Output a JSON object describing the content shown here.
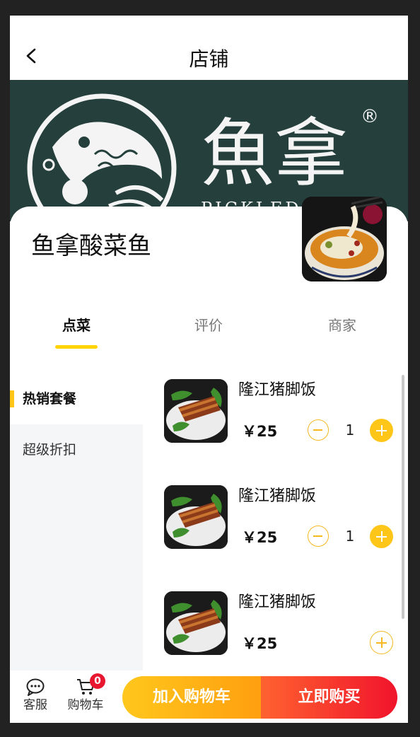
{
  "header": {
    "title": "店铺",
    "back_icon": "chevron-left-icon"
  },
  "banner": {
    "brand_cn": "魚拿",
    "brand_en": "PICKLED FISH",
    "registered_mark": "®",
    "bg_color": "#25403c"
  },
  "store": {
    "name": "鱼拿酸菜鱼"
  },
  "tabs": [
    {
      "label": "点菜",
      "active": true
    },
    {
      "label": "评价",
      "active": false
    },
    {
      "label": "商家",
      "active": false
    }
  ],
  "sidebar": {
    "items": [
      {
        "label": "热销套餐",
        "active": true
      },
      {
        "label": "超级折扣",
        "active": false
      }
    ]
  },
  "products": [
    {
      "name": "隆江猪脚饭",
      "price": "￥25",
      "qty": "1"
    },
    {
      "name": "隆江猪脚饭",
      "price": "￥25",
      "qty": "1"
    },
    {
      "name": "隆江猪脚饭",
      "price": "￥25",
      "qty": ""
    }
  ],
  "bottom": {
    "service_label": "客服",
    "service_icon": "chat-bubble-icon",
    "cart_label": "购物车",
    "cart_icon": "shopping-cart-icon",
    "cart_count": "0",
    "add_to_cart": "加入购物车",
    "buy_now": "立即购买"
  },
  "colors": {
    "accent_yellow": "#FFC61A",
    "accent_red": "#F0142C",
    "badge_red": "#E8162E"
  }
}
